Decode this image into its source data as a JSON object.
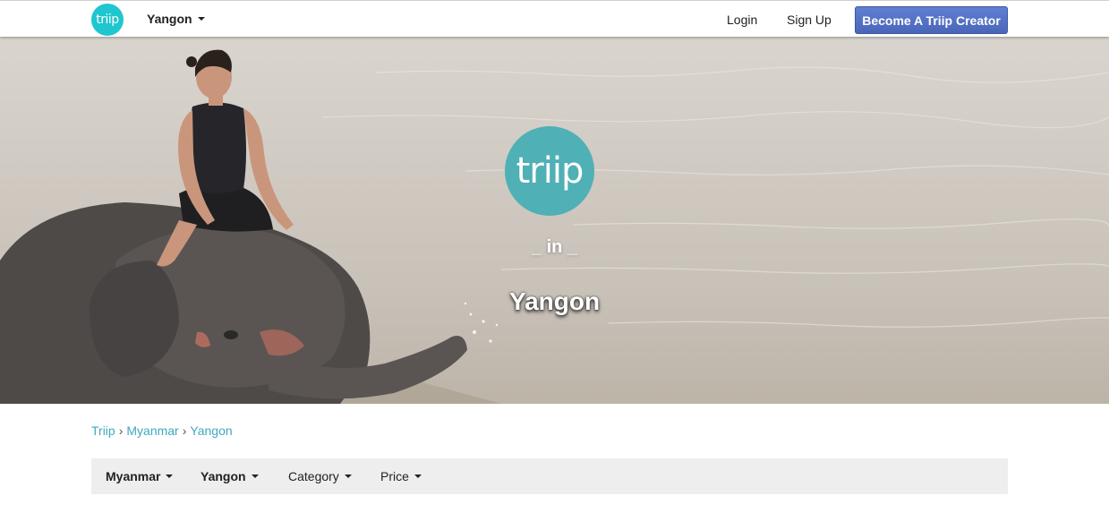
{
  "nav": {
    "logo_text": "triip",
    "city_selector": "Yangon",
    "login": "Login",
    "signup": "Sign Up",
    "cta": "Become A Triip Creator"
  },
  "hero": {
    "logo_text": "triip",
    "in_text": "_ in _",
    "city": "Yangon"
  },
  "breadcrumb": [
    "Triip",
    "Myanmar",
    "Yangon"
  ],
  "filters": {
    "country": "Myanmar",
    "city": "Yangon",
    "category": "Category",
    "price": "Price"
  },
  "colors": {
    "logo_teal": "#1fc6cf",
    "hero_logo": "#4fb0b6",
    "cta_blue": "#4a66b8",
    "link": "#3fa9c0",
    "filter_bg": "#eeeeee"
  }
}
